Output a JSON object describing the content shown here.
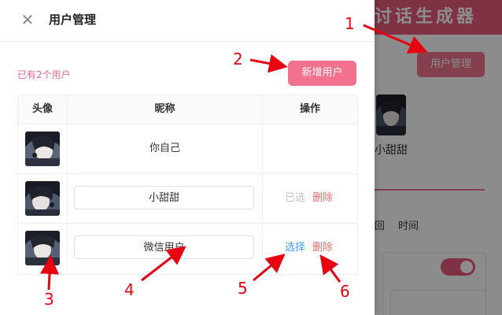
{
  "background": {
    "banner_text": "讨话生成器",
    "user_mgmt_button": "用户管理",
    "profile_name": "小甜甜",
    "tab_1": "回",
    "tab_2": "时间"
  },
  "drawer": {
    "title": "用户管理",
    "close_icon": "close-icon",
    "user_count": "已有2个用户",
    "add_button": "新增用户"
  },
  "table": {
    "headers": [
      "头像",
      "昵称",
      "操作"
    ],
    "rows": [
      {
        "avatar": "avatar-image",
        "name": "你自己",
        "editable": false,
        "actions": []
      },
      {
        "avatar": "avatar-image",
        "name": "小甜甜",
        "editable": true,
        "actions": [
          "已选",
          "删除"
        ]
      },
      {
        "avatar": "avatar-image",
        "name": "微信用户",
        "editable": true,
        "actions": [
          "选择",
          "删除"
        ]
      }
    ]
  },
  "annotations": [
    "1",
    "2",
    "3",
    "4",
    "5",
    "6"
  ],
  "colors": {
    "accent_pink": "#f2718d",
    "link_blue": "#409eff",
    "delete_red": "#f56c6c",
    "annotation_red": "#e60012"
  }
}
